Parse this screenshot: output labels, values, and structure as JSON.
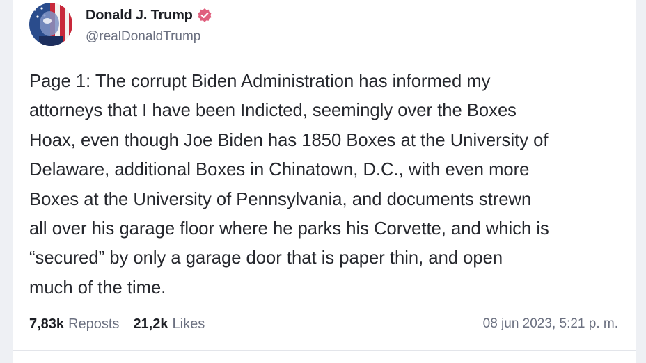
{
  "post": {
    "author": {
      "display_name": "Donald J. Trump",
      "handle": "@realDonaldTrump",
      "verified_icon": "verified-badge-icon",
      "verified_color": "#e0607e"
    },
    "text": "Page 1: The corrupt Biden Administration has informed my\nattorneys that I have been Indicted, seemingly over the Boxes\nHoax, even though Joe Biden has 1850 Boxes at the University of\nDelaware, additional Boxes in Chinatown, D.C., with even more\nBoxes at the University of Pennsylvania, and documents strewn\nall over his garage floor where he parks his Corvette, and which is\n“secured” by only a garage door that is paper thin, and open\nmuch of the time.",
    "stats": {
      "reposts_count": "7,83k",
      "reposts_label": "Reposts",
      "likes_count": "21,2k",
      "likes_label": "Likes"
    },
    "timestamp": "08 jun 2023, 5:21 p. m."
  }
}
